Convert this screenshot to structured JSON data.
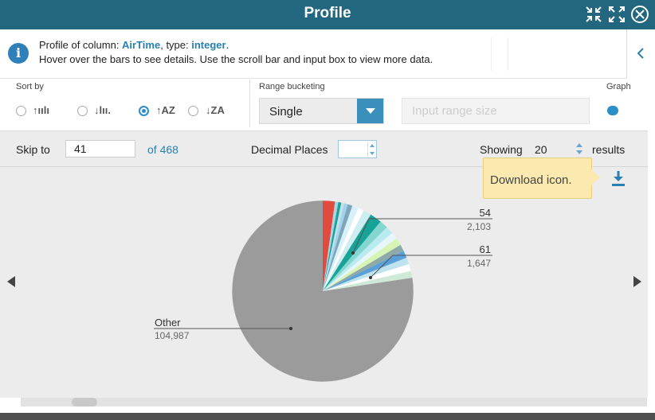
{
  "window": {
    "title": "Profile"
  },
  "info": {
    "line1_prefix": "Profile of column: ",
    "column_name": "AirTime",
    "line1_mid": ", type: ",
    "column_type": "integer",
    "line1_suffix": ".",
    "line2": "Hover over the bars to see details. Use the scroll bar and input box to view more data."
  },
  "controls": {
    "sort_label": "Sort by",
    "sort_options": [
      "↑ıılı",
      "↓lıı.",
      "↑AZ",
      "↓ZA"
    ],
    "sort_selected_index": 2,
    "range_label": "Range bucketing",
    "range_value": "Single",
    "range_input_placeholder": "Input range size",
    "graph_label": "Graph",
    "graph_on": true
  },
  "paging": {
    "skip_label": "Skip to",
    "skip_value": "41",
    "of_total": "of 468",
    "decimal_label": "Decimal Places",
    "decimal_value": "",
    "showing_label": "Showing",
    "showing_value": "20",
    "results_label": "results"
  },
  "tooltip": {
    "text": "Download icon."
  },
  "icons": {
    "info": "info-icon",
    "minimize": "compress-icon",
    "maximize": "expand-icon",
    "close": "close-circle-icon",
    "collapse": "chevron-left-icon",
    "download": "download-icon",
    "prev": "triangle-left-icon",
    "next": "triangle-right-icon"
  },
  "colors": {
    "titlebar": "#23667f",
    "accent": "#2a8fc6",
    "other_slice": "#9b9b9b",
    "tooltip_bg": "#fbe9b0"
  },
  "chart_data": {
    "type": "pie",
    "slices": [
      {
        "label": "54",
        "value": 2103,
        "color": "#17a398"
      },
      {
        "label": "61",
        "value": 1647,
        "color": "#a6d7e8"
      },
      {
        "label": "Other",
        "value": 104987,
        "color": "#9b9b9b"
      }
    ],
    "labels_shown": [
      {
        "name": "54",
        "value_text": "2,103"
      },
      {
        "name": "61",
        "value_text": "1,647"
      },
      {
        "name": "Other",
        "value_text": "104,987"
      }
    ]
  }
}
